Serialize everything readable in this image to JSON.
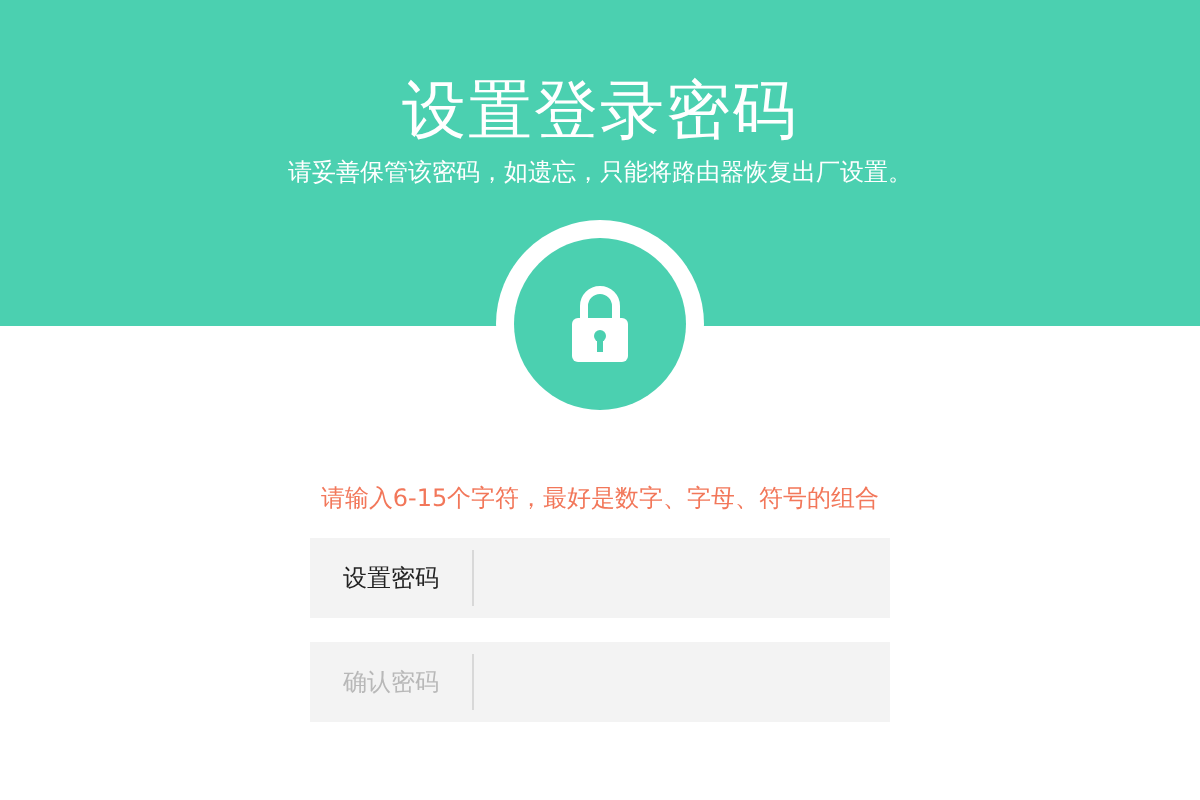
{
  "header": {
    "title": "设置登录密码",
    "subtitle": "请妥善保管该密码，如遗忘，只能将路由器恢复出厂设置。"
  },
  "hint": "请输入6-15个字符，最好是数字、字母、符号的组合",
  "fields": [
    {
      "label": "设置密码",
      "disabled": false
    },
    {
      "label": "确认密码",
      "disabled": true
    }
  ]
}
